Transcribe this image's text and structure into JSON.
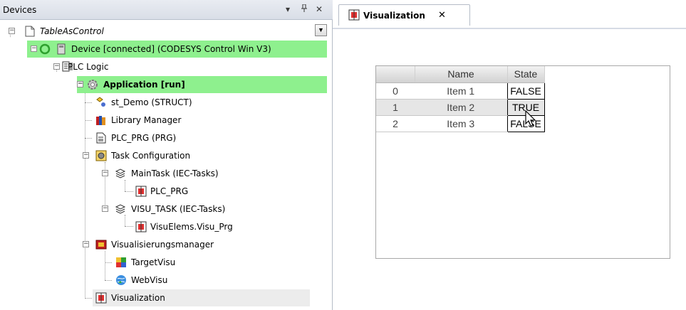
{
  "devices_panel": {
    "title": "Devices",
    "controls": {
      "dropdown": "▾",
      "pin": "ᵖ",
      "close": "✕"
    }
  },
  "tree": {
    "project": "TableAsControl",
    "device": "Device [connected] (CODESYS Control Win V3)",
    "plc_logic": "PLC Logic",
    "application": "Application [run]",
    "st_demo": "st_Demo (STRUCT)",
    "library_manager": "Library Manager",
    "plc_prg": "PLC_PRG (PRG)",
    "task_configuration": "Task Configuration",
    "main_task": "MainTask (IEC-Tasks)",
    "main_task_call": "PLC_PRG",
    "visu_task": "VISU_TASK (IEC-Tasks)",
    "visu_task_call": "VisuElems.Visu_Prg",
    "visu_manager": "Visualisierungsmanager",
    "target_visu": "TargetVisu",
    "web_visu": "WebVisu",
    "visualization": "Visualization"
  },
  "editor": {
    "tab_label": "Visualization",
    "tab_close": "✕"
  },
  "table": {
    "headers": [
      "",
      "Name",
      "State"
    ],
    "rows": [
      {
        "index": "0",
        "name": "Item 1",
        "state": "FALSE"
      },
      {
        "index": "1",
        "name": "Item 2",
        "state": "TRUE"
      },
      {
        "index": "2",
        "name": "Item 3",
        "state": "FALSE"
      }
    ]
  },
  "colors": {
    "highlight": "#8ef08e",
    "selected": "#ececec",
    "panel_header": "#dde2ea"
  }
}
